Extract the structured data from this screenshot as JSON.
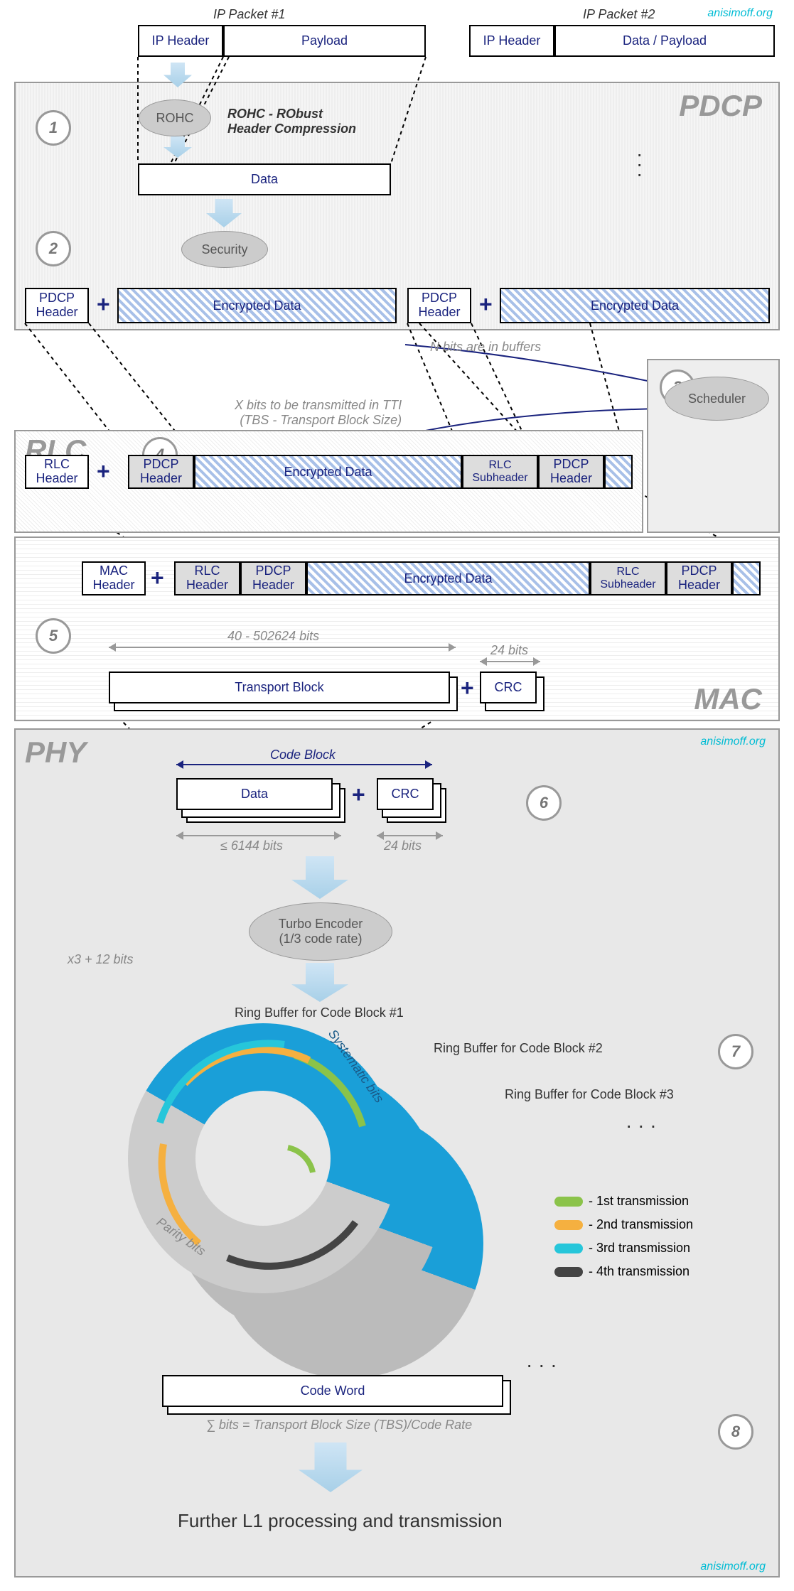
{
  "watermark": "anisimoff.org",
  "ip_packets": {
    "p1_label": "IP Packet #1",
    "p2_label": "IP Packet #2",
    "ip_header": "IP Header",
    "payload": "Payload",
    "data_payload": "Data / Payload"
  },
  "layers": {
    "pdcp": "PDCP",
    "rlc": "RLC",
    "mac": "MAC",
    "phy": "PHY"
  },
  "pdcp": {
    "rohc": "ROHC",
    "rohc_text": "ROHC - RObust\nHeader Compression",
    "data": "Data",
    "security": "Security",
    "pdcp_header": "PDCP\nHeader",
    "encrypted": "Encrypted Data"
  },
  "scheduler": {
    "n_bits": "N bits are in buffers",
    "scheduler": "Scheduler",
    "x_bits": "X bits to be transmitted in TTI\n(TBS - Transport Block Size)"
  },
  "rlc": {
    "rlc_header": "RLC\nHeader",
    "pdcp_header": "PDCP\nHeader",
    "encrypted": "Encrypted Data",
    "rlc_subheader": "RLC\nSubheader",
    "rlc_subheader_short": "RLC\nSubheader"
  },
  "mac": {
    "mac_header": "MAC\nHeader",
    "rlc_header": "RLC\nHeader",
    "pdcp_header": "PDCP\nHeader",
    "encrypted": "Encrypted Data",
    "tb": "Transport Block",
    "crc": "CRC",
    "bits_range": "40 - 502624 bits",
    "crc_bits": "24 bits"
  },
  "phy": {
    "code_block": "Code Block",
    "data": "Data",
    "crc": "CRC",
    "data_bits": "≤ 6144 bits",
    "crc_bits": "24 bits",
    "turbo": "Turbo Encoder\n(1/3 code rate)",
    "x3": "x3 + 12 bits",
    "rb1": "Ring Buffer for Code Block #1",
    "rb2": "Ring Buffer for Code Block #2",
    "rb3": "Ring Buffer for Code Block #3",
    "systematic": "Systematic bits",
    "parity": "Parity bits",
    "code_word": "Code Word",
    "sum_bits": "∑ bits = Transport Block Size (TBS)/Code Rate",
    "further": "Further L1 processing and transmission",
    "legend": {
      "t1": "1st transmission",
      "t2": "2nd transmission",
      "t3": "3rd transmission",
      "t4": "4th transmission"
    }
  },
  "steps": [
    "1",
    "2",
    "3",
    "4",
    "5",
    "6",
    "7",
    "8"
  ]
}
